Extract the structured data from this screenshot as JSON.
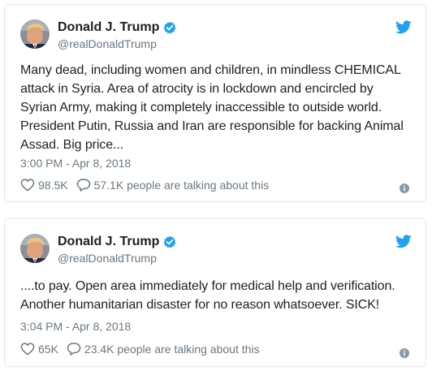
{
  "colors": {
    "twitter_blue": "#1da1f2",
    "text_primary": "#1c2022",
    "text_secondary": "#697882",
    "border": "#e1e8ed"
  },
  "icons": {
    "verified": "verified-badge-icon",
    "brand": "twitter-bird-icon",
    "like": "heart-icon",
    "reply": "speech-bubble-icon",
    "info": "info-icon"
  },
  "tweets": [
    {
      "author": {
        "name": "Donald J. Trump",
        "handle": "@realDonaldTrump"
      },
      "text": "Many dead, including women and children, in mindless CHEMICAL\nattack in Syria. Area of atrocity is in lockdown and encircled by\nSyrian Army, making it completely inaccessible to outside world.\nPresident Putin, Russia and Iran are responsible for backing Animal\nAssad. Big price...",
      "timestamp": "3:00 PM - Apr 8, 2018",
      "likes": "98.5K",
      "talking": "57.1K people are talking about this"
    },
    {
      "author": {
        "name": "Donald J. Trump",
        "handle": "@realDonaldTrump"
      },
      "text": "....to pay. Open area immediately for medical help and verification.\nAnother humanitarian disaster for no reason whatsoever. SICK!",
      "timestamp": "3:04 PM - Apr 8, 2018",
      "likes": "65K",
      "talking": "23.4K people are talking about this"
    }
  ]
}
